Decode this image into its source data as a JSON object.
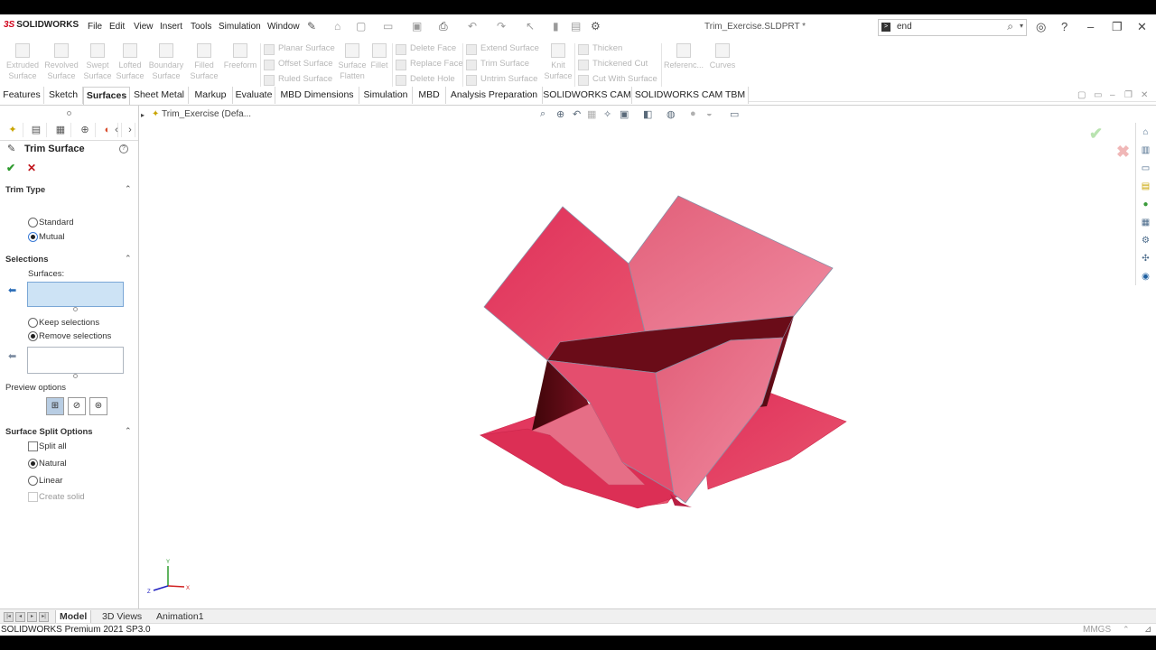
{
  "app": {
    "logo_text": "SOLIDWORKS",
    "document_title": "Trim_Exercise.SLDPRT *",
    "search_value": "end",
    "version_text": "SOLIDWORKS Premium 2021 SP3.0",
    "units": "MMGS"
  },
  "menu": [
    "File",
    "Edit",
    "View",
    "Insert",
    "Tools",
    "Simulation",
    "Window"
  ],
  "toolbar": {
    "big_tools": [
      {
        "line1": "Extruded",
        "line2": "Surface"
      },
      {
        "line1": "Revolved",
        "line2": "Surface"
      },
      {
        "line1": "Swept",
        "line2": "Surface"
      },
      {
        "line1": "Lofted",
        "line2": "Surface"
      },
      {
        "line1": "Boundary",
        "line2": "Surface"
      },
      {
        "line1": "Filled",
        "line2": "Surface"
      },
      {
        "line1": "Freeform",
        "line2": ""
      }
    ],
    "col1": [
      "Planar Surface",
      "Offset Surface",
      "Ruled Surface"
    ],
    "surface_flatten": {
      "line1": "Surface",
      "line2": "Flatten"
    },
    "fillet": "Fillet",
    "col2": [
      "Delete Face",
      "Replace Face",
      "Delete Hole"
    ],
    "col3": [
      "Extend Surface",
      "Trim Surface",
      "Untrim Surface"
    ],
    "knit": {
      "line1": "Knit",
      "line2": "Surface"
    },
    "col4": [
      "Thicken",
      "Thickened Cut",
      "Cut With Surface"
    ],
    "reference": "Referenc...",
    "curves": "Curves"
  },
  "tabs": [
    {
      "label": "Features",
      "active": false
    },
    {
      "label": "Sketch",
      "active": false
    },
    {
      "label": "Surfaces",
      "active": true
    },
    {
      "label": "Sheet Metal",
      "active": false
    },
    {
      "label": "Markup",
      "active": false
    },
    {
      "label": "Evaluate",
      "active": false
    },
    {
      "label": "MBD Dimensions",
      "active": false
    },
    {
      "label": "Simulation",
      "active": false
    },
    {
      "label": "MBD",
      "active": false
    },
    {
      "label": "Analysis Preparation",
      "active": false
    },
    {
      "label": "SOLIDWORKS CAM",
      "active": false
    },
    {
      "label": "SOLIDWORKS CAM TBM",
      "active": false
    }
  ],
  "property_manager": {
    "title": "Trim Surface",
    "help": "?",
    "trim_type": {
      "heading": "Trim Type",
      "options": [
        {
          "label": "Standard",
          "selected": false
        },
        {
          "label": "Mutual",
          "selected": true
        }
      ]
    },
    "selections": {
      "heading": "Selections",
      "surfaces_label": "Surfaces:",
      "keep_remove": [
        {
          "label": "Keep selections",
          "selected": false
        },
        {
          "label": "Remove selections",
          "selected": true
        }
      ]
    },
    "preview_heading": "Preview options",
    "split": {
      "heading": "Surface Split Options",
      "split_all": {
        "label": "Split all",
        "checked": false
      },
      "options": [
        {
          "label": "Natural",
          "selected": true
        },
        {
          "label": "Linear",
          "selected": false
        }
      ],
      "create_solid": {
        "label": "Create solid",
        "checked": false,
        "enabled": false
      }
    }
  },
  "graphics": {
    "tree_root": "Trim_Exercise  (Defa...",
    "model_colors": {
      "light": "#e8778f",
      "mid": "#dc3a5c",
      "dark": "#5e0a14",
      "edge": "#8a8fa6"
    },
    "triad": {
      "x": "X",
      "y": "Y",
      "z": "Z"
    }
  },
  "bottom_tabs": [
    {
      "label": "Model",
      "active": true
    },
    {
      "label": "3D Views",
      "active": false
    },
    {
      "label": "Animation1",
      "active": false
    }
  ]
}
